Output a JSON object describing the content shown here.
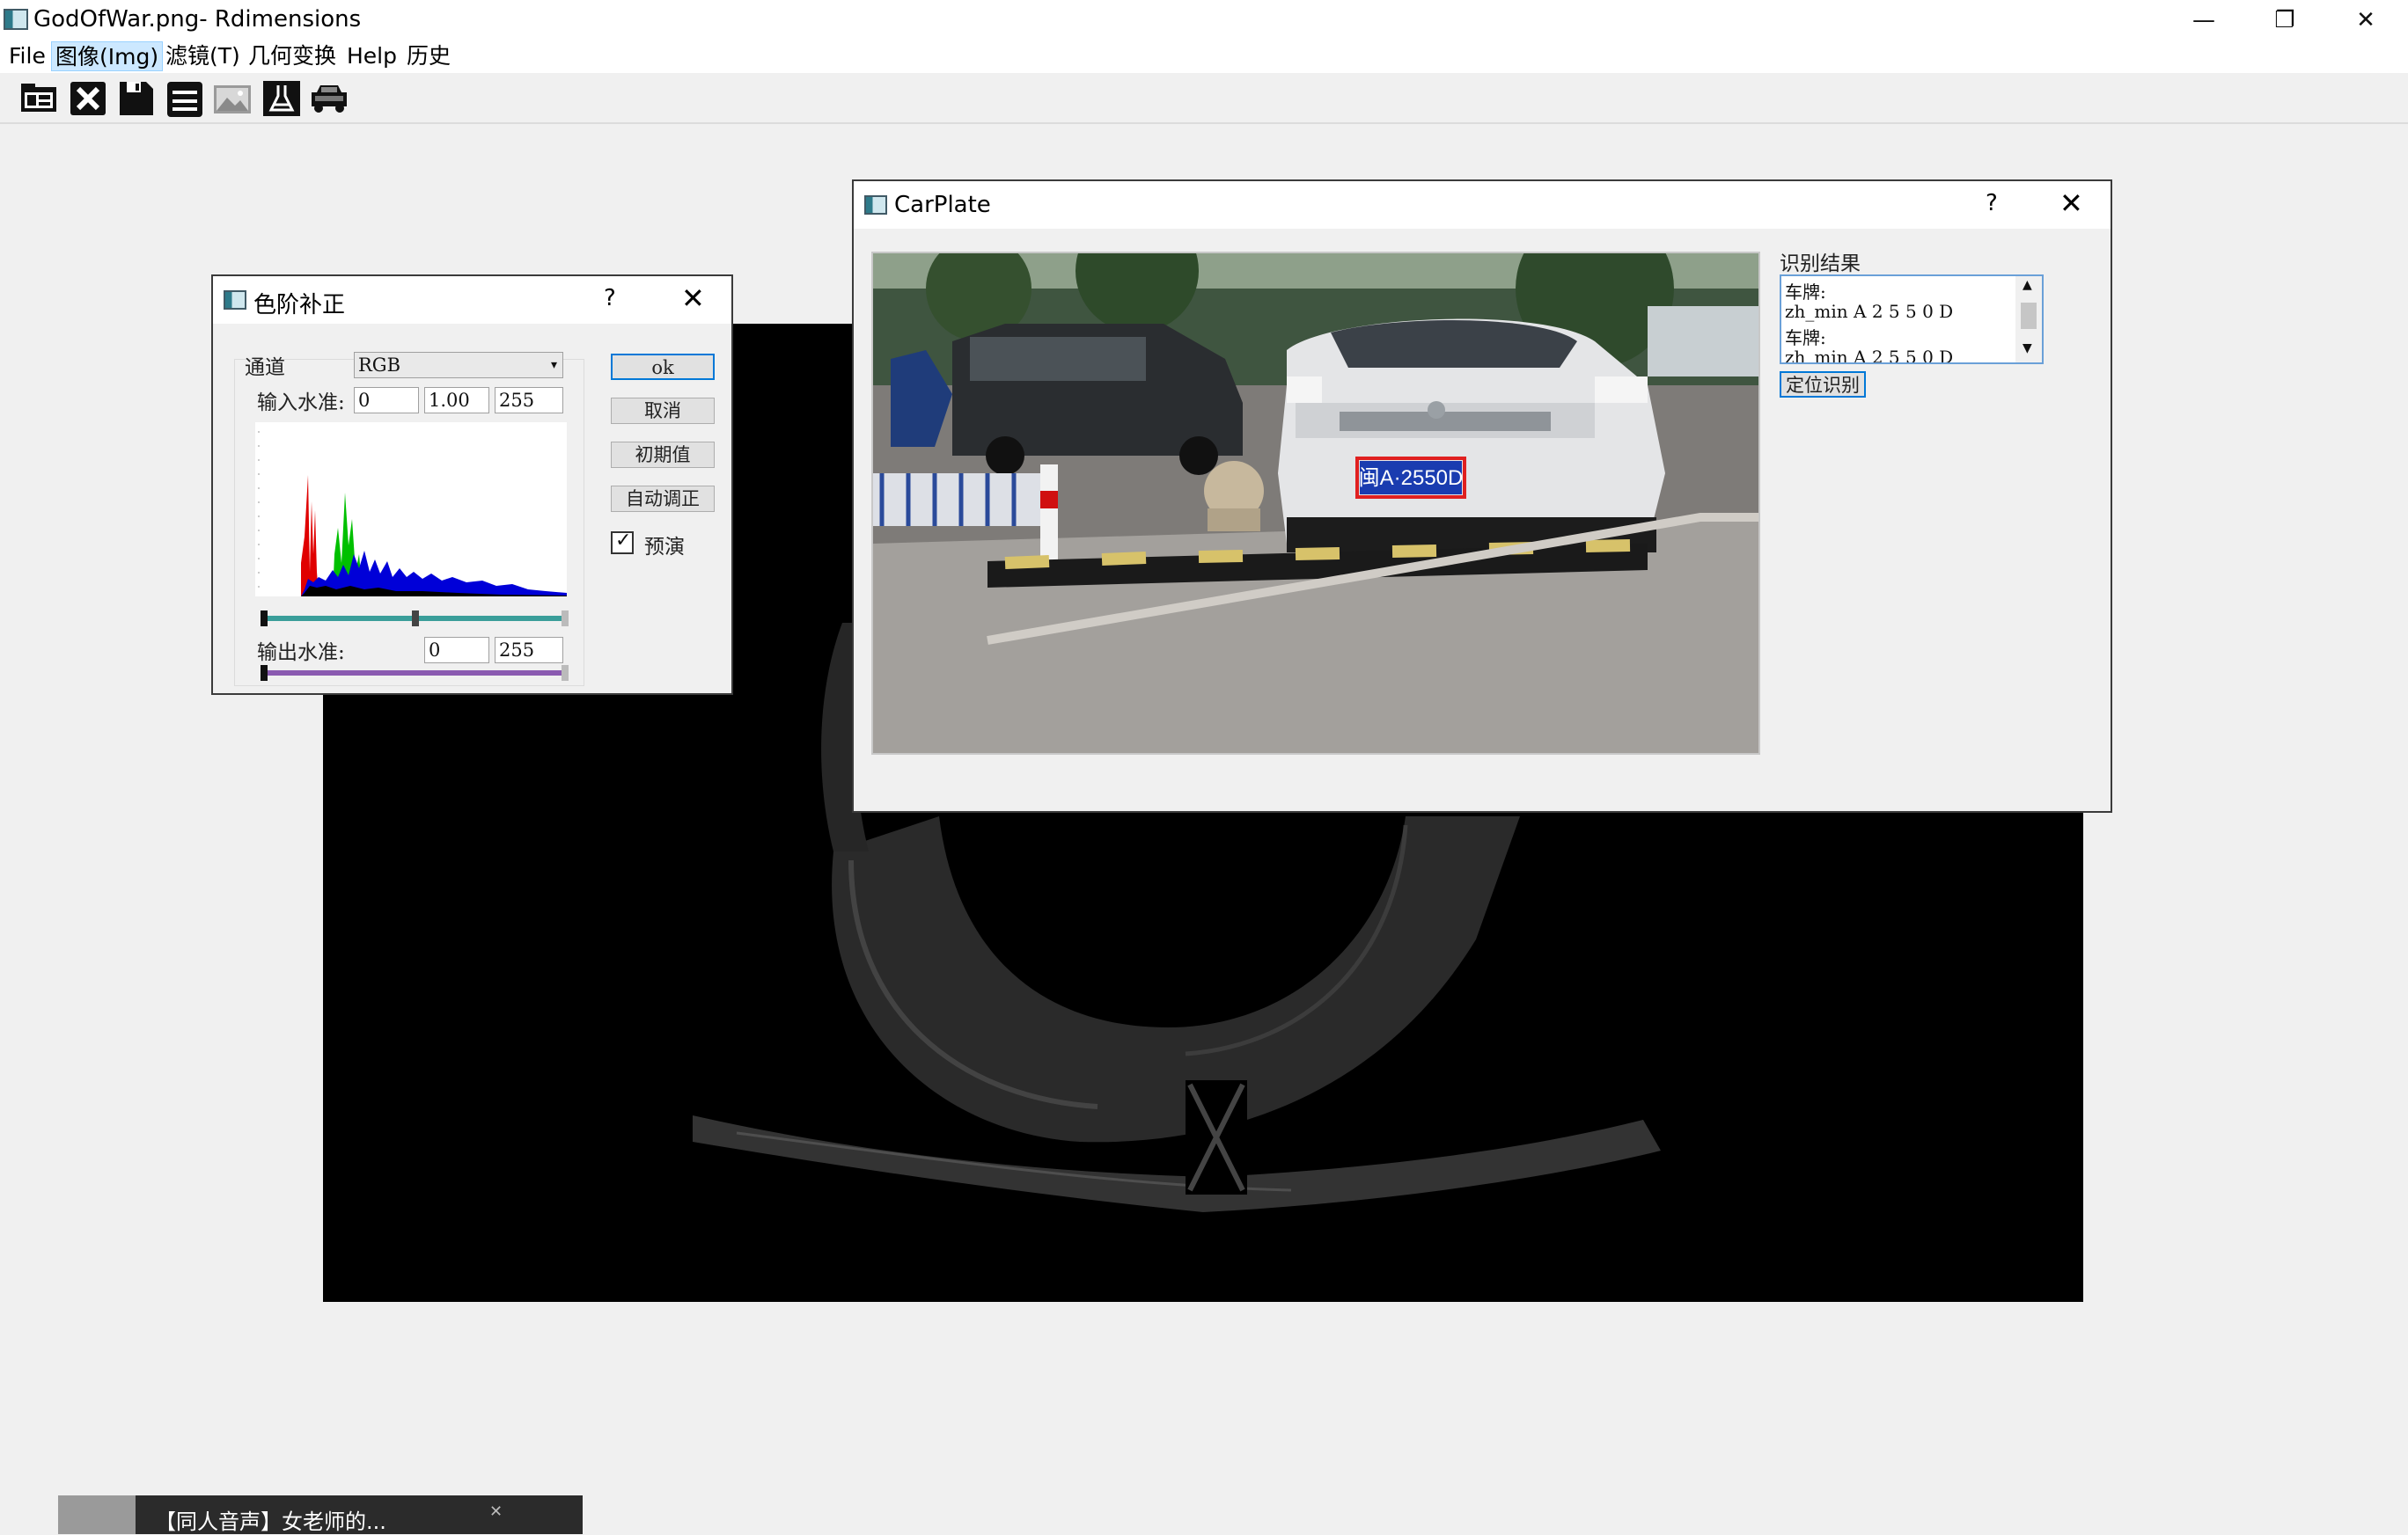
{
  "window": {
    "title": "GodOfWar.png- Rdimensions",
    "controls": {
      "minimize": "—",
      "restore": "❐",
      "close": "✕"
    }
  },
  "menu": {
    "items": [
      "File",
      "图像(Img)",
      "滤镜(T)",
      "几何变换",
      "Help",
      "历史"
    ]
  },
  "toolbar": {
    "tools": [
      "open-image-icon",
      "close-image-icon",
      "save-icon",
      "print-icon",
      "picture-icon",
      "filter-icon",
      "car-icon"
    ]
  },
  "levels_dialog": {
    "title": "色阶补正",
    "help": "?",
    "close": "✕",
    "channel_label": "通道",
    "channel_value": "RGB",
    "input_label": "输入水准:",
    "input_values": [
      "0",
      "1.00",
      "255"
    ],
    "output_label": "输出水准:",
    "output_values": [
      "0",
      "255"
    ],
    "buttons": {
      "ok": "ok",
      "cancel": "取消",
      "initial": "初期值",
      "auto": "自动调正"
    },
    "preview_label": "预演",
    "preview_checked": true,
    "colors": {
      "input_track": "#3a9e9a",
      "output_track": "#8a5ab0"
    }
  },
  "carplate_dialog": {
    "title": "CarPlate",
    "help": "?",
    "close": "✕",
    "result_label": "识别结果",
    "result_lines": [
      "车牌:",
      "zh_min A 2 5 5 0 D",
      "车牌:",
      "zh_min A 2 5 5 0 D"
    ],
    "locate_button": "定位识别",
    "plate_text": "闽A·2550D",
    "highlight_color": "#e02020"
  },
  "taskbar_media": {
    "title": "【同人音声】女老师的..."
  }
}
